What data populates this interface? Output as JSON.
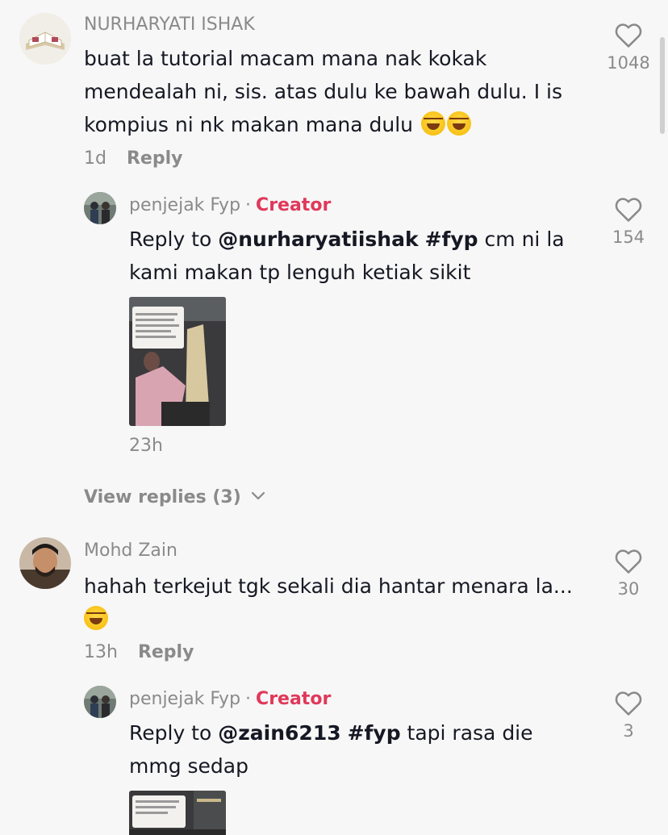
{
  "comments": [
    {
      "name": "NURHARYATI ISHAK",
      "text": "buat la tutorial macam mana nak kokak mendealah ni, sis. atas dulu ke bawah dulu. I is kompius ni nk makan mana dulu",
      "time": "1d",
      "reply_label": "Reply",
      "likes": "1048",
      "avatar_icon": "quran-book-avatar",
      "emoji": [
        "😂",
        "😂"
      ]
    },
    {
      "name": "penjejak Fyp",
      "creator_label": "Creator",
      "reply_prefix": "Reply to",
      "mention": "@nurharyatiishak",
      "hashtag": "#fyp",
      "text": "cm ni la kami makan tp lenguh ketiak sikit",
      "time": "23h",
      "likes": "154",
      "avatar_icon": "group-photo-avatar"
    },
    {
      "name": "Mohd Zain",
      "text": "hahah terkejut tgk sekali dia hantar menara la...",
      "time": "13h",
      "reply_label": "Reply",
      "likes": "30",
      "avatar_icon": "man-portrait-avatar",
      "emoji": [
        "😂"
      ]
    },
    {
      "name": "penjejak Fyp",
      "creator_label": "Creator",
      "reply_prefix": "Reply to",
      "mention": "@zain6213",
      "hashtag": "#fyp",
      "text": " tapi rasa die mmg sedap",
      "likes": "3",
      "avatar_icon": "group-photo-avatar"
    }
  ],
  "view_replies": "View replies (3)",
  "colors": {
    "background": "#f7f7f7",
    "text": "#161823",
    "muted": "#8a8a8a",
    "creator": "#e0385a"
  }
}
